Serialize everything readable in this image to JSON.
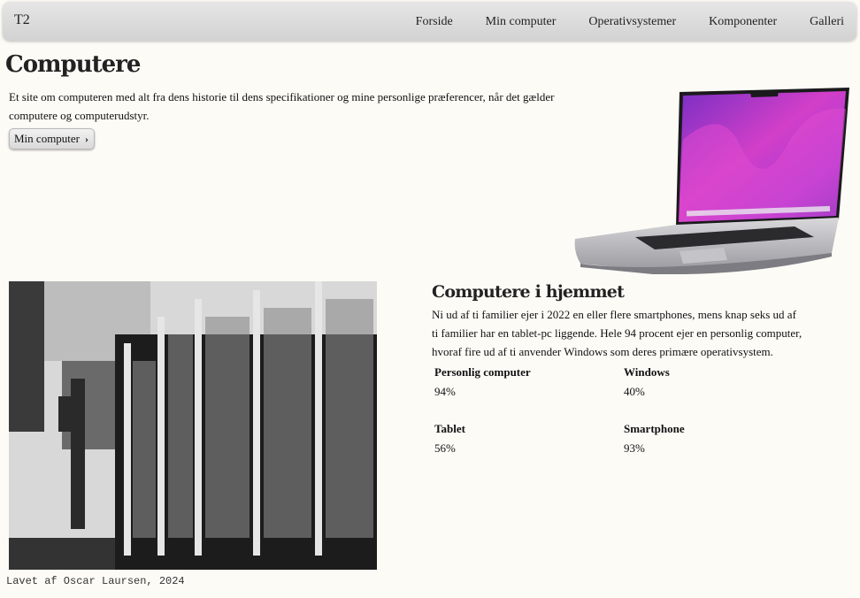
{
  "nav": {
    "brand": "T2",
    "links": [
      "Forside",
      "Min computer",
      "Operativsystemer",
      "Komponenter",
      "Galleri"
    ]
  },
  "hero": {
    "title": "Computere",
    "text": "Et site om computeren med alt fra dens historie til dens specifikationer og mine personlige præferencer, når det gælder computere og computerudstyr.",
    "button_label": "Min computer"
  },
  "home_section": {
    "title": "Computere i hjemmet",
    "text": "Ni ud af ti familier ejer i 2022 en eller flere smartphones, mens knap seks ud af ti familier har en tablet-pc liggende. Hele 94 procent ejer en personlig computer, hvoraf fire ud af ti anvender Windows som deres primære operativsystem.",
    "stats": [
      {
        "label": "Personlig computer",
        "value": "94%"
      },
      {
        "label": "Windows",
        "value": "40%"
      },
      {
        "label": "Tablet",
        "value": "56%"
      },
      {
        "label": "Smartphone",
        "value": "93%"
      }
    ]
  },
  "footer": {
    "caption": "Lavet af Oscar Laursen, 2024"
  },
  "colors": {
    "background": "#fdfbf6",
    "navbar": "#dcdcdc",
    "wallpaper_magenta": "#c63fd0",
    "wallpaper_purple": "#6a2bbf"
  }
}
